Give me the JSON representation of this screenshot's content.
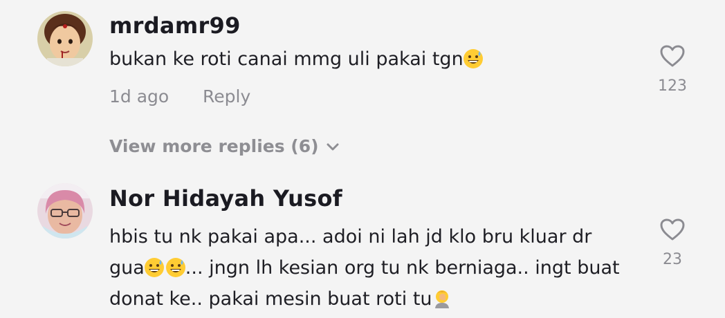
{
  "comments": [
    {
      "username": "mrdamr99",
      "text": "bukan ke roti canai mmg uli pakai tgn",
      "emoji": "grinning-sweat-emoji",
      "time": "1d ago",
      "reply_label": "Reply",
      "likes": "123",
      "view_more": "View more replies (6)"
    },
    {
      "username": "Nor Hidayah Yusof",
      "lines": [
        "hbis tu nk pakai apa... adoi ni lah jd klo bru kluar dr",
        "gua",
        "... jngn lh kesian org tu nk berniaga.. ingt buat",
        "donat ke.. pakai mesin buat roti tu"
      ],
      "emojis": [
        "grinning-sweat-emoji",
        "grinning-sweat-emoji",
        "facepalm-emoji"
      ],
      "likes": "23"
    }
  ],
  "icons": {
    "like": "heart-outline-icon",
    "expand": "chevron-down-icon"
  },
  "colors": {
    "background": "#f4f4f4",
    "secondary_text": "#8b8b91",
    "primary_text": "#1e1e24"
  }
}
